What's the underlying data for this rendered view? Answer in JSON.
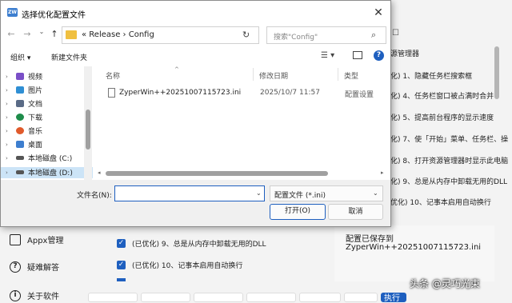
{
  "background_app": {
    "sidebar": [
      {
        "label": "Appx管理",
        "icon": "package-icon"
      },
      {
        "label": "疑难解答",
        "icon": "question-icon"
      },
      {
        "label": "关于软件",
        "icon": "info-icon"
      }
    ],
    "checked_items": [
      "(已优化) 9、总是从内存中卸载无用的DLL",
      "(已优化) 10、记事本启用自动换行"
    ],
    "right_list_header": "源管理器",
    "right_list": [
      "化) 1、隐藏任务栏搜索框",
      "化) 4、任务栏窗口被占满时合并",
      "化) 5、提高前台程序的显示速度",
      "化) 7、使「开始」菜单、任务栏、操",
      "化) 8、打开资源管理器时显示此电脑",
      "化) 9、总是从内存中卸载无用的DLL",
      "优化) 10、记事本启用自动换行"
    ],
    "result_line1": "配置已保存到",
    "result_line2": "ZyperWin++20251007115723.ini",
    "bottom_partial": "执行"
  },
  "dialog": {
    "title": "选择优化配置文件",
    "close_glyph": "✕",
    "nav": {
      "back": "←",
      "forward": "→",
      "dropdown": "⌄",
      "up": "↑"
    },
    "address": "«  Release  ›  Config",
    "address_chevron": "⌄",
    "refresh": "↻",
    "search_placeholder": "搜索\"Config\"",
    "search_icon": "⌕",
    "toolbar": {
      "organize": "组织 ▾",
      "new_folder": "新建文件夹",
      "view": "☰ ▾",
      "help": "?"
    },
    "navpane": [
      {
        "label": "视频",
        "icon": "video-icon",
        "color": "#7a4fc7"
      },
      {
        "label": "图片",
        "icon": "picture-icon",
        "color": "#2f8fd4"
      },
      {
        "label": "文档",
        "icon": "document-icon",
        "color": "#5a6b86"
      },
      {
        "label": "下载",
        "icon": "download-icon",
        "color": "#1e8c4a"
      },
      {
        "label": "音乐",
        "icon": "music-icon",
        "color": "#e05a2b"
      },
      {
        "label": "桌面",
        "icon": "desktop-icon",
        "color": "#3d7ecf"
      },
      {
        "label": "本地磁盘 (C:)",
        "icon": "drive-icon",
        "color": "#555555"
      },
      {
        "label": "本地磁盘 (D:)",
        "icon": "drive-icon",
        "color": "#555555"
      }
    ],
    "columns": {
      "name": "名称",
      "date": "修改日期",
      "type": "类型"
    },
    "files": [
      {
        "name": "ZyperWin++20251007115723.ini",
        "date": "2025/10/7 11:57",
        "type": "配置设置"
      }
    ],
    "filename_label": "文件名(N):",
    "filename_value": "",
    "filename_chevron": "⌄",
    "filetype": "配置文件 (*.ini)",
    "filetype_chevron": "⌄",
    "open_label": "打开(O)",
    "cancel_label": "取消"
  },
  "watermark": "头条 @灵巧光束",
  "colors": {
    "accent": "#1e5fbf",
    "selection": "#cce4f7"
  }
}
